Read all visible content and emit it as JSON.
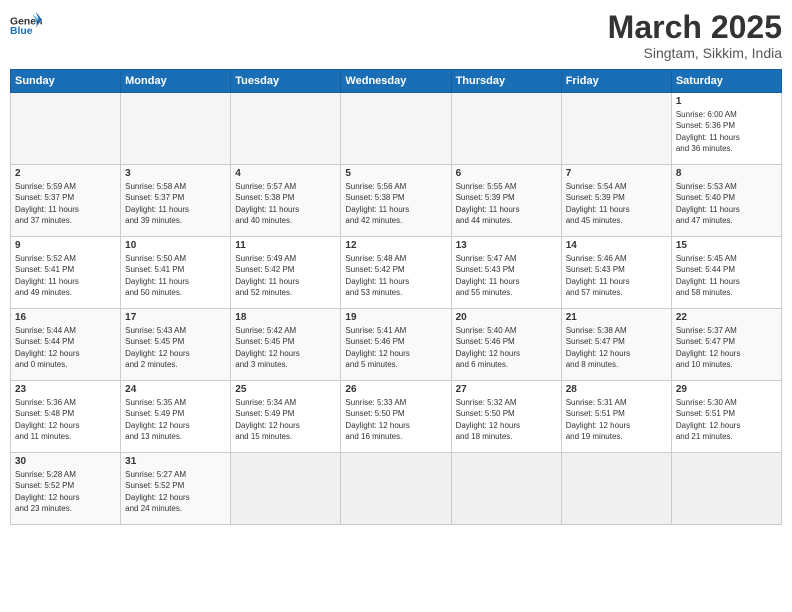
{
  "header": {
    "logo_general": "General",
    "logo_blue": "Blue",
    "month_year": "March 2025",
    "location": "Singtam, Sikkim, India"
  },
  "weekdays": [
    "Sunday",
    "Monday",
    "Tuesday",
    "Wednesday",
    "Thursday",
    "Friday",
    "Saturday"
  ],
  "weeks": [
    [
      {
        "day": "",
        "info": ""
      },
      {
        "day": "",
        "info": ""
      },
      {
        "day": "",
        "info": ""
      },
      {
        "day": "",
        "info": ""
      },
      {
        "day": "",
        "info": ""
      },
      {
        "day": "",
        "info": ""
      },
      {
        "day": "1",
        "info": "Sunrise: 6:00 AM\nSunset: 5:36 PM\nDaylight: 11 hours\nand 36 minutes."
      }
    ],
    [
      {
        "day": "2",
        "info": "Sunrise: 5:59 AM\nSunset: 5:37 PM\nDaylight: 11 hours\nand 37 minutes."
      },
      {
        "day": "3",
        "info": "Sunrise: 5:58 AM\nSunset: 5:37 PM\nDaylight: 11 hours\nand 39 minutes."
      },
      {
        "day": "4",
        "info": "Sunrise: 5:57 AM\nSunset: 5:38 PM\nDaylight: 11 hours\nand 40 minutes."
      },
      {
        "day": "5",
        "info": "Sunrise: 5:56 AM\nSunset: 5:38 PM\nDaylight: 11 hours\nand 42 minutes."
      },
      {
        "day": "6",
        "info": "Sunrise: 5:55 AM\nSunset: 5:39 PM\nDaylight: 11 hours\nand 44 minutes."
      },
      {
        "day": "7",
        "info": "Sunrise: 5:54 AM\nSunset: 5:39 PM\nDaylight: 11 hours\nand 45 minutes."
      },
      {
        "day": "8",
        "info": "Sunrise: 5:53 AM\nSunset: 5:40 PM\nDaylight: 11 hours\nand 47 minutes."
      }
    ],
    [
      {
        "day": "9",
        "info": "Sunrise: 5:52 AM\nSunset: 5:41 PM\nDaylight: 11 hours\nand 49 minutes."
      },
      {
        "day": "10",
        "info": "Sunrise: 5:50 AM\nSunset: 5:41 PM\nDaylight: 11 hours\nand 50 minutes."
      },
      {
        "day": "11",
        "info": "Sunrise: 5:49 AM\nSunset: 5:42 PM\nDaylight: 11 hours\nand 52 minutes."
      },
      {
        "day": "12",
        "info": "Sunrise: 5:48 AM\nSunset: 5:42 PM\nDaylight: 11 hours\nand 53 minutes."
      },
      {
        "day": "13",
        "info": "Sunrise: 5:47 AM\nSunset: 5:43 PM\nDaylight: 11 hours\nand 55 minutes."
      },
      {
        "day": "14",
        "info": "Sunrise: 5:46 AM\nSunset: 5:43 PM\nDaylight: 11 hours\nand 57 minutes."
      },
      {
        "day": "15",
        "info": "Sunrise: 5:45 AM\nSunset: 5:44 PM\nDaylight: 11 hours\nand 58 minutes."
      }
    ],
    [
      {
        "day": "16",
        "info": "Sunrise: 5:44 AM\nSunset: 5:44 PM\nDaylight: 12 hours\nand 0 minutes."
      },
      {
        "day": "17",
        "info": "Sunrise: 5:43 AM\nSunset: 5:45 PM\nDaylight: 12 hours\nand 2 minutes."
      },
      {
        "day": "18",
        "info": "Sunrise: 5:42 AM\nSunset: 5:45 PM\nDaylight: 12 hours\nand 3 minutes."
      },
      {
        "day": "19",
        "info": "Sunrise: 5:41 AM\nSunset: 5:46 PM\nDaylight: 12 hours\nand 5 minutes."
      },
      {
        "day": "20",
        "info": "Sunrise: 5:40 AM\nSunset: 5:46 PM\nDaylight: 12 hours\nand 6 minutes."
      },
      {
        "day": "21",
        "info": "Sunrise: 5:38 AM\nSunset: 5:47 PM\nDaylight: 12 hours\nand 8 minutes."
      },
      {
        "day": "22",
        "info": "Sunrise: 5:37 AM\nSunset: 5:47 PM\nDaylight: 12 hours\nand 10 minutes."
      }
    ],
    [
      {
        "day": "23",
        "info": "Sunrise: 5:36 AM\nSunset: 5:48 PM\nDaylight: 12 hours\nand 11 minutes."
      },
      {
        "day": "24",
        "info": "Sunrise: 5:35 AM\nSunset: 5:49 PM\nDaylight: 12 hours\nand 13 minutes."
      },
      {
        "day": "25",
        "info": "Sunrise: 5:34 AM\nSunset: 5:49 PM\nDaylight: 12 hours\nand 15 minutes."
      },
      {
        "day": "26",
        "info": "Sunrise: 5:33 AM\nSunset: 5:50 PM\nDaylight: 12 hours\nand 16 minutes."
      },
      {
        "day": "27",
        "info": "Sunrise: 5:32 AM\nSunset: 5:50 PM\nDaylight: 12 hours\nand 18 minutes."
      },
      {
        "day": "28",
        "info": "Sunrise: 5:31 AM\nSunset: 5:51 PM\nDaylight: 12 hours\nand 19 minutes."
      },
      {
        "day": "29",
        "info": "Sunrise: 5:30 AM\nSunset: 5:51 PM\nDaylight: 12 hours\nand 21 minutes."
      }
    ],
    [
      {
        "day": "30",
        "info": "Sunrise: 5:28 AM\nSunset: 5:52 PM\nDaylight: 12 hours\nand 23 minutes."
      },
      {
        "day": "31",
        "info": "Sunrise: 5:27 AM\nSunset: 5:52 PM\nDaylight: 12 hours\nand 24 minutes."
      },
      {
        "day": "",
        "info": ""
      },
      {
        "day": "",
        "info": ""
      },
      {
        "day": "",
        "info": ""
      },
      {
        "day": "",
        "info": ""
      },
      {
        "day": "",
        "info": ""
      }
    ]
  ]
}
